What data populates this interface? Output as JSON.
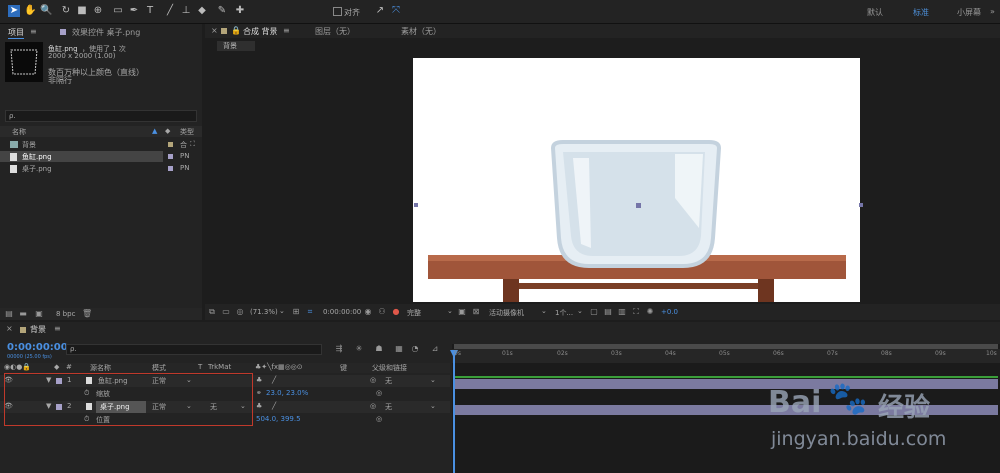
{
  "toolbar": {
    "snap_label": "对齐",
    "workspaces": [
      "默认",
      "标准",
      "小屏幕"
    ],
    "active_workspace": "标准",
    "menu_icon": "double-chevron-icon"
  },
  "project": {
    "tab_label": "项目",
    "effects_tab_label": "效果控件 桌子.png",
    "preview_name": "鱼缸.png",
    "preview_used": "，使用了 1 次",
    "preview_dims": "2000 x 2000 (1.00)",
    "preview_color": "数百万种以上颜色（直线）",
    "preview_interlace": "非隔行",
    "search_placeholder": "ρ.",
    "col_name": "名称",
    "col_type": "类型",
    "items": [
      {
        "name": "背景",
        "type": "合",
        "color": "#b3a57a",
        "selected": false
      },
      {
        "name": "鱼缸.png",
        "type": "PN",
        "color": "#a6a0c8",
        "selected": true
      },
      {
        "name": "桌子.png",
        "type": "PN",
        "color": "#a6a0c8",
        "selected": false
      }
    ],
    "bpc": "8 bpc"
  },
  "composition": {
    "tab_label": "合成 背景",
    "layer_tab": "图层（无）",
    "footage_tab": "素材（无）",
    "breadcrumb": "背景",
    "zoom": "(71.3%)",
    "timecode": "0:00:00:00",
    "quality": "完整",
    "camera": "活动摄像机",
    "views": "1个...",
    "exposure": "+0.0"
  },
  "timeline": {
    "tab_label": "背景",
    "timecode": "0:00:00:00",
    "fps": "00000 (25.00 fps)",
    "search_placeholder": "ρ.",
    "col_source": "源名称",
    "col_mode": "模式",
    "col_t": "T",
    "col_trkmat": "TrkMat",
    "col_key": "键",
    "col_parent": "父级和链接",
    "ruler": [
      "0s",
      "01s",
      "02s",
      "03s",
      "04s",
      "05s",
      "06s",
      "07s",
      "08s",
      "09s",
      "10s"
    ],
    "layers": [
      {
        "num": "1",
        "name": "鱼缸.png",
        "mode": "正常",
        "trkmat": "",
        "parent": "无",
        "prop_name": "缩放",
        "prop_value": "23.0, 23.0%",
        "color": "#a6a0c8"
      },
      {
        "num": "2",
        "name": "桌子.png",
        "mode": "正常",
        "trkmat": "无",
        "parent": "无",
        "prop_name": "位置",
        "prop_value": "504.0, 399.5",
        "color": "#a6a0c8"
      }
    ]
  },
  "watermark": {
    "brand": "Bai",
    "brand2": "经验",
    "url": "jingyan.baidu.com"
  },
  "colors": {
    "accent": "#2d6dbd",
    "timecode_blue": "#4a90e2",
    "selection_red": "#c0392b",
    "track_bar": "#7b7aa0",
    "work_area": "#3a9e3a"
  }
}
